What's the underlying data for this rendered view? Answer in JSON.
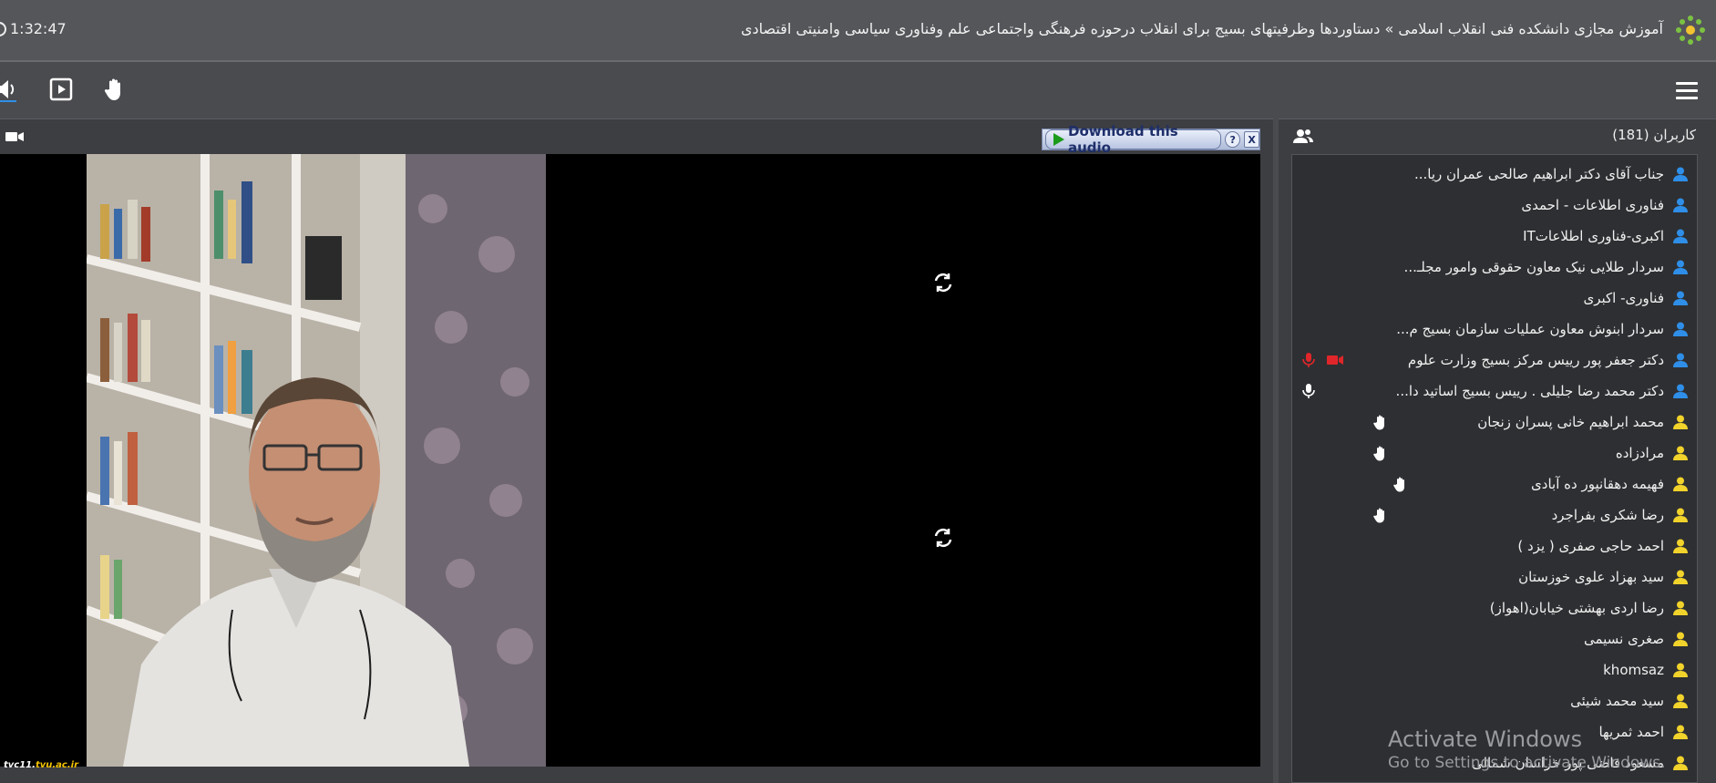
{
  "header": {
    "timer": "1:32:47",
    "title": "آموزش مجازی دانشکده فنی انقلاب اسلامی » دستاوردها وظرفیتهای بسیج برای انقلاب درحوزه فرهنگی واجتماعی علم وفناوری سیاسی وامنیتی اقتصادی"
  },
  "toolbar": {
    "icons": [
      "speaker-icon",
      "play-square-icon",
      "raise-hand-icon",
      "menu-icon"
    ]
  },
  "video": {
    "download_label": "Download this audio",
    "help_label": "?",
    "close_label": "X",
    "brand_prefix": "tvc11.",
    "brand_domain": "tvu.ac.ir"
  },
  "users": {
    "title": "کاربران (181)",
    "items": [
      {
        "name": "جناب آقای دکتر ابراهیم صالحی عمران ریا...",
        "role": "presenter",
        "status": ""
      },
      {
        "name": "فناوری اطلاعات - احمدی",
        "role": "presenter",
        "status": ""
      },
      {
        "name": "اکبری-فناوری اطلاعاتIT",
        "role": "presenter",
        "status": ""
      },
      {
        "name": "سردار طلایی نیک معاون حقوقی وامور مجلـ...",
        "role": "presenter",
        "status": ""
      },
      {
        "name": "فناوری- اکبری",
        "role": "presenter",
        "status": ""
      },
      {
        "name": "سردار ابنوش معاون عملیات سازمان بسیج م...",
        "role": "presenter",
        "status": ""
      },
      {
        "name": "دکتر جعفر پور رییس مرکز بسیج وزارت علوم",
        "role": "presenter",
        "status": "mic-cam"
      },
      {
        "name": "دکتر محمد رضا جلیلی . رییس بسیج اساتید دا...",
        "role": "presenter",
        "status": "mic"
      },
      {
        "name": "محمد ابراهیم خانی پسران زنجان",
        "role": "participant",
        "status": "hand"
      },
      {
        "name": "مرادزاده",
        "role": "participant",
        "status": "hand"
      },
      {
        "name": "فهیمه دهقانپور ده آبادی",
        "role": "participant",
        "status": "hand2"
      },
      {
        "name": "رضا شکری بفراجرد",
        "role": "participant",
        "status": "hand"
      },
      {
        "name": "احمد حاجی صفری ( یزد )",
        "role": "participant",
        "status": ""
      },
      {
        "name": "سید بهزاد علوی خوزستان",
        "role": "participant",
        "status": ""
      },
      {
        "name": "رضا اردی بهشتی خیابان(اهواز)",
        "role": "participant",
        "status": ""
      },
      {
        "name": "صغری نسیمی",
        "role": "participant",
        "status": ""
      },
      {
        "name": "khomsaz",
        "role": "participant",
        "status": ""
      },
      {
        "name": "سید محمد شیئی",
        "role": "participant",
        "status": ""
      },
      {
        "name": "احمد ثمریها",
        "role": "participant",
        "status": ""
      },
      {
        "name": "مسعود قاضی پور خراسان شمالی",
        "role": "participant",
        "status": ""
      }
    ]
  },
  "overlay": {
    "activate_title": "Activate Windows",
    "activate_sub": "Go to Settings to activate Windows."
  },
  "colors": {
    "presenter": "#2f8fe8",
    "participant": "#f2d32b",
    "alert": "#e0262a"
  }
}
